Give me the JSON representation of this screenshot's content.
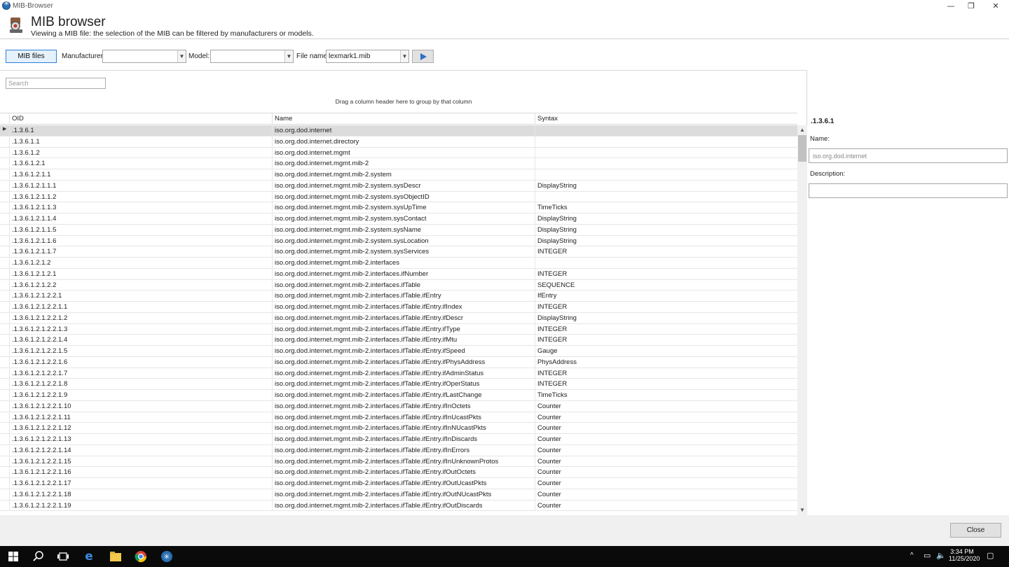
{
  "window": {
    "title": "MIB-Browser"
  },
  "header": {
    "title": "MIB browser",
    "subtitle": "Viewing a MIB file: the selection of the MIB can be filtered by manufacturers or models."
  },
  "toolbar": {
    "mib_files_label": "MIB files",
    "manufacturer_label": "Manufacturer:",
    "manufacturer_value": "",
    "model_label": "Model:",
    "model_value": "",
    "file_name_label": "File name:",
    "file_name_value": "lexmark1.mib"
  },
  "grid": {
    "search_placeholder": "Search",
    "group_by_hint": "Drag a column header here to group by that column",
    "columns": [
      "OID",
      "Name",
      "Syntax"
    ],
    "selected_index": 0,
    "rows": [
      [
        ".1.3.6.1",
        "iso.org.dod.internet",
        ""
      ],
      [
        ".1.3.6.1.1",
        "iso.org.dod.internet.directory",
        ""
      ],
      [
        ".1.3.6.1.2",
        "iso.org.dod.internet.mgmt",
        ""
      ],
      [
        ".1.3.6.1.2.1",
        "iso.org.dod.internet.mgmt.mib-2",
        ""
      ],
      [
        ".1.3.6.1.2.1.1",
        "iso.org.dod.internet.mgmt.mib-2.system",
        ""
      ],
      [
        ".1.3.6.1.2.1.1.1",
        "iso.org.dod.internet.mgmt.mib-2.system.sysDescr",
        "DisplayString"
      ],
      [
        ".1.3.6.1.2.1.1.2",
        "iso.org.dod.internet.mgmt.mib-2.system.sysObjectID",
        ""
      ],
      [
        ".1.3.6.1.2.1.1.3",
        "iso.org.dod.internet.mgmt.mib-2.system.sysUpTime",
        "TimeTicks"
      ],
      [
        ".1.3.6.1.2.1.1.4",
        "iso.org.dod.internet.mgmt.mib-2.system.sysContact",
        "DisplayString"
      ],
      [
        ".1.3.6.1.2.1.1.5",
        "iso.org.dod.internet.mgmt.mib-2.system.sysName",
        "DisplayString"
      ],
      [
        ".1.3.6.1.2.1.1.6",
        "iso.org.dod.internet.mgmt.mib-2.system.sysLocation",
        "DisplayString"
      ],
      [
        ".1.3.6.1.2.1.1.7",
        "iso.org.dod.internet.mgmt.mib-2.system.sysServices",
        "INTEGER"
      ],
      [
        ".1.3.6.1.2.1.2",
        "iso.org.dod.internet.mgmt.mib-2.interfaces",
        ""
      ],
      [
        ".1.3.6.1.2.1.2.1",
        "iso.org.dod.internet.mgmt.mib-2.interfaces.ifNumber",
        "INTEGER"
      ],
      [
        ".1.3.6.1.2.1.2.2",
        "iso.org.dod.internet.mgmt.mib-2.interfaces.ifTable",
        "SEQUENCE"
      ],
      [
        ".1.3.6.1.2.1.2.2.1",
        "iso.org.dod.internet.mgmt.mib-2.interfaces.ifTable.ifEntry",
        "IfEntry"
      ],
      [
        ".1.3.6.1.2.1.2.2.1.1",
        "iso.org.dod.internet.mgmt.mib-2.interfaces.ifTable.ifEntry.ifIndex",
        "INTEGER"
      ],
      [
        ".1.3.6.1.2.1.2.2.1.2",
        "iso.org.dod.internet.mgmt.mib-2.interfaces.ifTable.ifEntry.ifDescr",
        "DisplayString"
      ],
      [
        ".1.3.6.1.2.1.2.2.1.3",
        "iso.org.dod.internet.mgmt.mib-2.interfaces.ifTable.ifEntry.ifType",
        "INTEGER"
      ],
      [
        ".1.3.6.1.2.1.2.2.1.4",
        "iso.org.dod.internet.mgmt.mib-2.interfaces.ifTable.ifEntry.ifMtu",
        "INTEGER"
      ],
      [
        ".1.3.6.1.2.1.2.2.1.5",
        "iso.org.dod.internet.mgmt.mib-2.interfaces.ifTable.ifEntry.ifSpeed",
        "Gauge"
      ],
      [
        ".1.3.6.1.2.1.2.2.1.6",
        "iso.org.dod.internet.mgmt.mib-2.interfaces.ifTable.ifEntry.ifPhysAddress",
        "PhysAddress"
      ],
      [
        ".1.3.6.1.2.1.2.2.1.7",
        "iso.org.dod.internet.mgmt.mib-2.interfaces.ifTable.ifEntry.ifAdminStatus",
        "INTEGER"
      ],
      [
        ".1.3.6.1.2.1.2.2.1.8",
        "iso.org.dod.internet.mgmt.mib-2.interfaces.ifTable.ifEntry.ifOperStatus",
        "INTEGER"
      ],
      [
        ".1.3.6.1.2.1.2.2.1.9",
        "iso.org.dod.internet.mgmt.mib-2.interfaces.ifTable.ifEntry.ifLastChange",
        "TimeTicks"
      ],
      [
        ".1.3.6.1.2.1.2.2.1.10",
        "iso.org.dod.internet.mgmt.mib-2.interfaces.ifTable.ifEntry.ifInOctets",
        "Counter"
      ],
      [
        ".1.3.6.1.2.1.2.2.1.11",
        "iso.org.dod.internet.mgmt.mib-2.interfaces.ifTable.ifEntry.ifInUcastPkts",
        "Counter"
      ],
      [
        ".1.3.6.1.2.1.2.2.1.12",
        "iso.org.dod.internet.mgmt.mib-2.interfaces.ifTable.ifEntry.ifInNUcastPkts",
        "Counter"
      ],
      [
        ".1.3.6.1.2.1.2.2.1.13",
        "iso.org.dod.internet.mgmt.mib-2.interfaces.ifTable.ifEntry.ifInDiscards",
        "Counter"
      ],
      [
        ".1.3.6.1.2.1.2.2.1.14",
        "iso.org.dod.internet.mgmt.mib-2.interfaces.ifTable.ifEntry.ifInErrors",
        "Counter"
      ],
      [
        ".1.3.6.1.2.1.2.2.1.15",
        "iso.org.dod.internet.mgmt.mib-2.interfaces.ifTable.ifEntry.ifInUnknownProtos",
        "Counter"
      ],
      [
        ".1.3.6.1.2.1.2.2.1.16",
        "iso.org.dod.internet.mgmt.mib-2.interfaces.ifTable.ifEntry.ifOutOctets",
        "Counter"
      ],
      [
        ".1.3.6.1.2.1.2.2.1.17",
        "iso.org.dod.internet.mgmt.mib-2.interfaces.ifTable.ifEntry.ifOutUcastPkts",
        "Counter"
      ],
      [
        ".1.3.6.1.2.1.2.2.1.18",
        "iso.org.dod.internet.mgmt.mib-2.interfaces.ifTable.ifEntry.ifOutNUcastPkts",
        "Counter"
      ],
      [
        ".1.3.6.1.2.1.2.2.1.19",
        "iso.org.dod.internet.mgmt.mib-2.interfaces.ifTable.ifEntry.ifOutDiscards",
        "Counter"
      ]
    ]
  },
  "details": {
    "oid": ".1.3.6.1",
    "name_label": "Name:",
    "name_value": "iso.org.dod.internet",
    "description_label": "Description:",
    "description_value": ""
  },
  "footer": {
    "close_label": "Close"
  },
  "taskbar": {
    "icons": [
      "windows-start-icon",
      "search-icon",
      "task-view-icon",
      "edge-icon",
      "file-explorer-icon",
      "chrome-icon",
      "mib-browser-app-icon"
    ],
    "time": "3:34 PM",
    "date": "11/25/2020"
  }
}
